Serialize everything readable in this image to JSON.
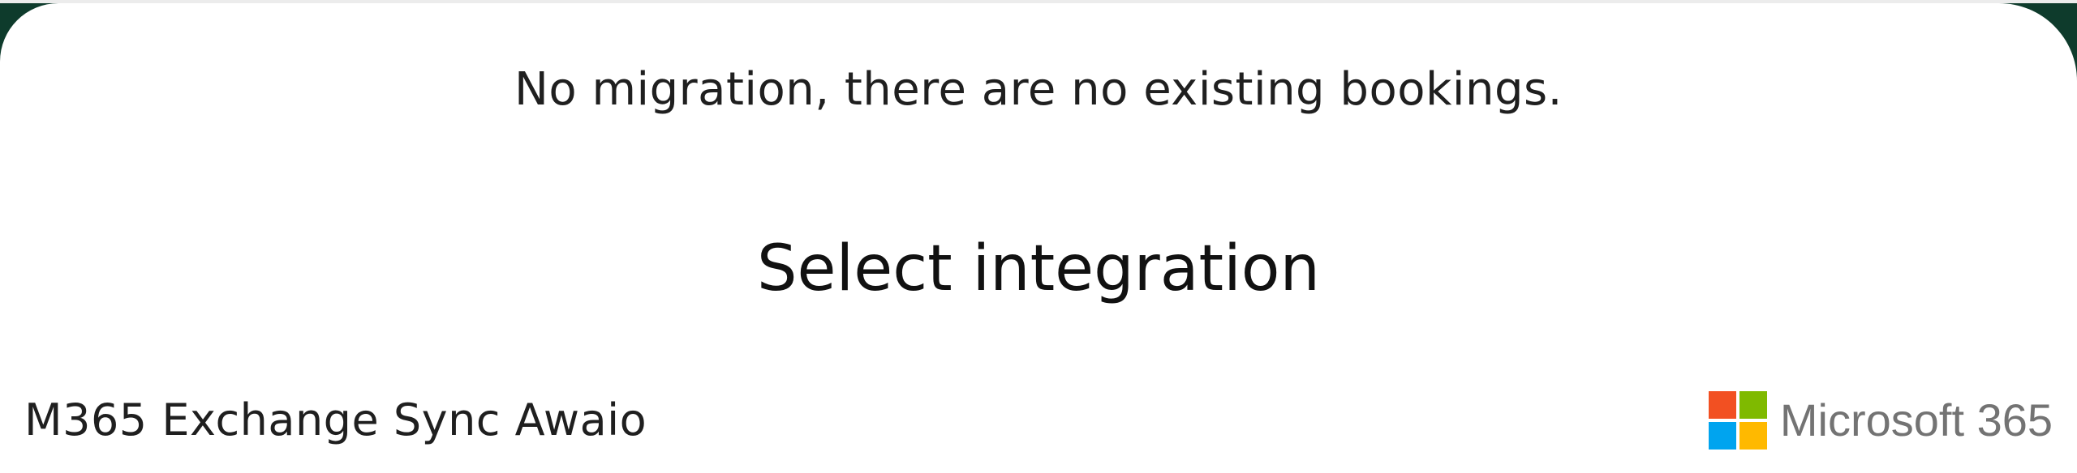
{
  "dialog": {
    "migration_message": "No migration, there are no existing bookings.",
    "section_title": "Select integration",
    "integrations": [
      {
        "name": "M365 Exchange Sync Awaio",
        "logo": {
          "icon": "microsoft-logo-icon",
          "text": "Microsoft 365",
          "colors": [
            "#F25022",
            "#7FBA00",
            "#00A4EF",
            "#FFB900"
          ]
        }
      }
    ]
  }
}
